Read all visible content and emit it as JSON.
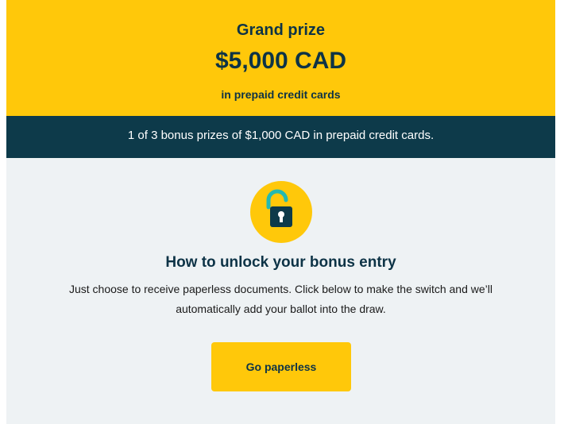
{
  "grand_prize": {
    "label": "Grand prize",
    "amount": "$5,000 CAD",
    "subtitle": "in prepaid credit cards"
  },
  "bonus_bar": {
    "text": "1 of 3 bonus prizes of $1,000 CAD in prepaid credit cards."
  },
  "unlock": {
    "icon": "unlocked-padlock-icon",
    "title": "How to unlock your bonus entry",
    "description": "Just choose to receive paperless documents. Click below to make the switch and we’ll automatically add your ballot into the draw."
  },
  "cta": {
    "label": "Go paperless"
  },
  "colors": {
    "accent_yellow": "#ffc80a",
    "navy": "#0d3a4a",
    "teal": "#25b9b0",
    "panel_bg": "#eef2f4"
  }
}
